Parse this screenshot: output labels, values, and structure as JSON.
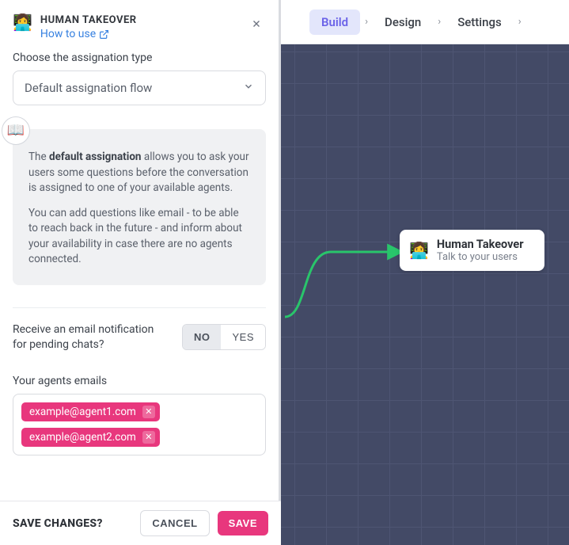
{
  "topbar": {
    "tabs": [
      {
        "label": "Build",
        "active": true
      },
      {
        "label": "Design",
        "active": false
      },
      {
        "label": "Settings",
        "active": false
      }
    ]
  },
  "panel": {
    "emoji": "👩‍💻",
    "title": "HUMAN TAKEOVER",
    "how_to_use": "How to use",
    "assignation_label": "Choose the assignation type",
    "assignation_value": "Default assignation flow",
    "info_emoji": "📖",
    "info_para1_pre": "The ",
    "info_para1_bold": "default assignation",
    "info_para1_post": " allows you to ask your users some questions before the conversation is assigned to one of your available agents.",
    "info_para2": "You can add questions like email - to be able to reach back in the future - and inform about your availability in case there are no agents connected.",
    "notify_label": "Receive an email notification for pending chats?",
    "notify_no": "NO",
    "notify_yes": "YES",
    "agents_label": "Your agents emails",
    "agents": [
      "example@agent1.com",
      "example@agent2.com"
    ]
  },
  "footer": {
    "title": "SAVE CHANGES?",
    "cancel": "CANCEL",
    "save": "SAVE"
  },
  "node": {
    "emoji": "👩‍💻",
    "title": "Human Takeover",
    "subtitle": "Talk to your users"
  }
}
